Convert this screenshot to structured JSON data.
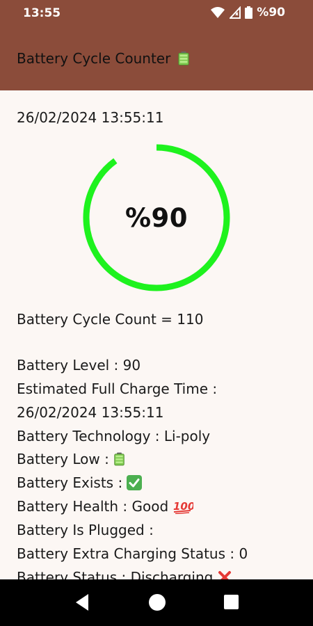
{
  "status_bar": {
    "time": "13:55",
    "battery_text": "%90",
    "icons": [
      "wifi-icon",
      "signal-icon",
      "battery-icon"
    ]
  },
  "app_bar": {
    "title": "Battery Cycle Counter",
    "title_icon": "battery-emoji-icon",
    "color": "#8b4c3a"
  },
  "main": {
    "datetime": "26/02/2024 13:55:11",
    "gauge": {
      "label": "%90",
      "level_percent": 90,
      "color": "#1ef21e"
    },
    "cycle_count": "Battery Cycle Count = 110",
    "details": {
      "level": "Battery Level : 90",
      "est_label": "Estimated Full Charge Time :",
      "est_value": "26/02/2024 13:55:11",
      "technology": "Battery Technology : Li-poly",
      "low": "Battery Low :",
      "exists": "Battery Exists :",
      "health": "Battery Health : Good",
      "plugged": "Battery Is Plugged :",
      "extra_status": "Battery Extra Charging Status : 0",
      "status": "Battery Status : Discharging"
    }
  },
  "nav_bar": {
    "icons": [
      "back-icon",
      "home-icon",
      "recents-icon"
    ]
  }
}
